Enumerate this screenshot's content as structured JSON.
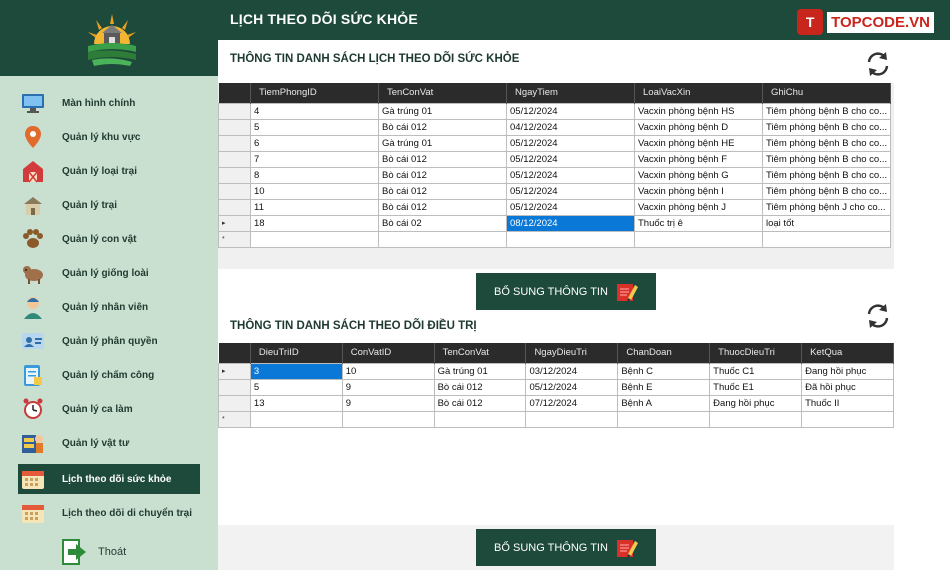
{
  "header": {
    "title": "LỊCH THEO DÕI SỨC KHỎE",
    "brand_text": "TOPCODE.VN",
    "brand_badge": "T"
  },
  "sidebar": {
    "items": [
      {
        "label": "Màn hình chính",
        "icon": "monitor-icon"
      },
      {
        "label": "Quản lý khu vực",
        "icon": "map-pin-icon"
      },
      {
        "label": "Quản lý loại trại",
        "icon": "barn-icon"
      },
      {
        "label": "Quản lý trại",
        "icon": "farm-house-icon"
      },
      {
        "label": "Quản lý con vật",
        "icon": "paw-icon"
      },
      {
        "label": "Quản lý giống loài",
        "icon": "cow-icon"
      },
      {
        "label": "Quản lý nhân viên",
        "icon": "employee-icon"
      },
      {
        "label": "Quản lý phân quyền",
        "icon": "id-card-icon"
      },
      {
        "label": "Quản lý chấm công",
        "icon": "clipboard-icon"
      },
      {
        "label": "Quản lý ca làm",
        "icon": "alarm-clock-icon"
      },
      {
        "label": "Quản lý vật tư",
        "icon": "supplies-icon"
      },
      {
        "label": "Lịch theo dõi sức khỏe",
        "icon": "calendar-icon",
        "active": true
      },
      {
        "label": "Lịch theo dõi di chuyển trại",
        "icon": "calendar-icon"
      }
    ],
    "exit_label": "Thoát"
  },
  "vaccination": {
    "title": "THÔNG TIN DANH SÁCH LỊCH THEO DÕI SỨC KHỎE",
    "columns": [
      "TiemPhongID",
      "TenConVat",
      "NgayTiem",
      "LoaiVacXin",
      "GhiChu"
    ],
    "rows": [
      [
        "4",
        "Gà trúng 01",
        "05/12/2024",
        "Vacxin phòng bệnh HS",
        "Tiêm phòng bệnh B cho co..."
      ],
      [
        "5",
        "Bò cái 012",
        "04/12/2024",
        "Vacxin phòng bệnh D",
        "Tiêm phòng bệnh B cho co..."
      ],
      [
        "6",
        "Gà trúng 01",
        "05/12/2024",
        "Vacxin phòng bệnh HE",
        "Tiêm phòng bệnh B cho co..."
      ],
      [
        "7",
        "Bò cái 012",
        "05/12/2024",
        "Vacxin phòng bệnh F",
        "Tiêm phòng bệnh B cho co..."
      ],
      [
        "8",
        "Bò cái 012",
        "05/12/2024",
        "Vacxin phòng bệnh G",
        "Tiêm phòng bệnh B cho co..."
      ],
      [
        "10",
        "Bò cái 012",
        "05/12/2024",
        "Vacxin phòng bệnh I",
        "Tiêm phòng bệnh B cho co..."
      ],
      [
        "11",
        "Bò cái 012",
        "05/12/2024",
        "Vacxin phòng bệnh J",
        "Tiêm phòng bệnh J cho co..."
      ],
      [
        "18",
        "Bò cái 02",
        "08/12/2024",
        "Thuốc trị ê",
        "loại tốt"
      ]
    ],
    "current_row_marker": "▸",
    "new_row_marker": "*",
    "submit_label": "BỔ SUNG THÔNG TIN"
  },
  "treatment": {
    "title": "THÔNG TIN DANH SÁCH THEO DÕI ĐIỀU TRỊ",
    "columns": [
      "DieuTriID",
      "ConVatID",
      "TenConVat",
      "NgayDieuTri",
      "ChanDoan",
      "ThuocDieuTri",
      "KetQua"
    ],
    "rows": [
      [
        "3",
        "10",
        "Gà trúng 01",
        "03/12/2024",
        "Bệnh C",
        "Thuốc C1",
        "Đang hồi phục"
      ],
      [
        "5",
        "9",
        "Bò cái 012",
        "05/12/2024",
        "Bệnh E",
        "Thuốc E1",
        "Đã hồi phục"
      ],
      [
        "13",
        "9",
        "Bò cái 012",
        "07/12/2024",
        "Bệnh A",
        "Đang hồi phục",
        "Thuốc II"
      ]
    ],
    "current_row_marker": "▸",
    "new_row_marker": "*",
    "submit_label": "BỔ SUNG THÔNG TIN"
  },
  "colors": {
    "dark_green": "#1e4a3c",
    "sidebar_bg": "#c9dfd0",
    "selection_blue": "#0a78d7",
    "brand_red": "#c8251c"
  }
}
